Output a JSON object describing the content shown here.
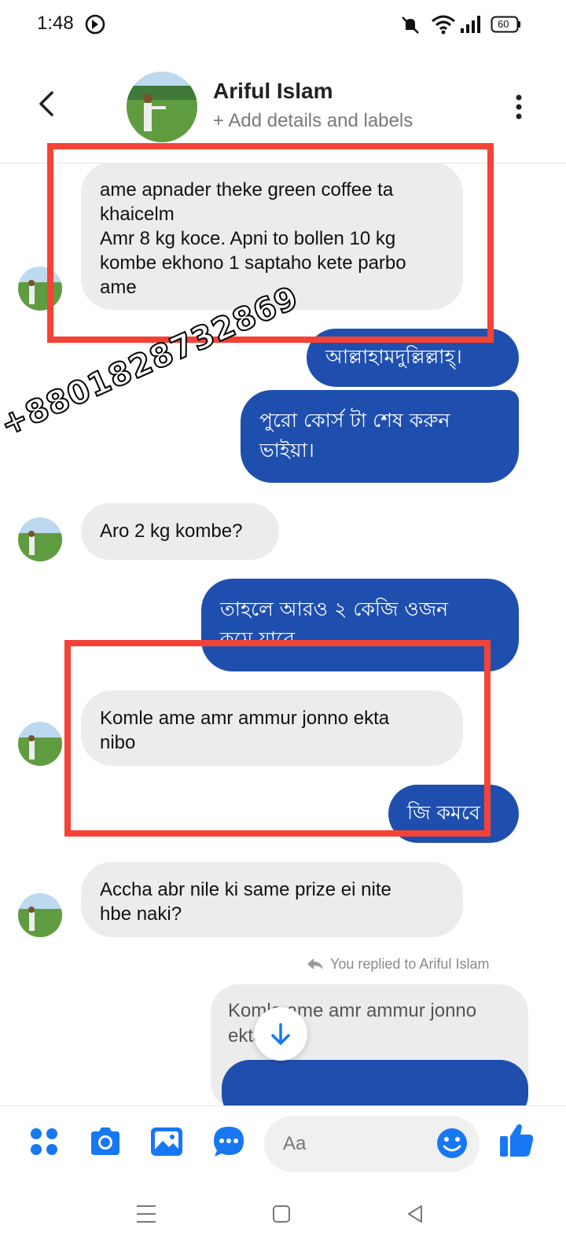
{
  "status_bar": {
    "time": "1:48",
    "battery": "60"
  },
  "header": {
    "name": "Ariful Islam",
    "subtitle": "+ Add details and labels"
  },
  "messages": {
    "m1": [
      "ame apnader theke green coffee ta",
      "khaicelm",
      "Amr 8 kg koce.  Apni to bollen 10 kg",
      "kombe ekhono 1 saptaho kete parbo",
      "ame"
    ],
    "m2": [
      "আল্লাহামদুল্লিল্লাহ্।"
    ],
    "m3": [
      "পুরো কোর্স টা শেষ করুন",
      "ভাইয়া।"
    ],
    "m4": [
      "Aro 2 kg kombe?"
    ],
    "m5": [
      "তাহলে আরও ২ কেজি ওজন",
      "কমে যাবে"
    ],
    "m6": [
      "Komle ame amr ammur jonno ekta",
      "nibo"
    ],
    "m7": [
      "জি কমবে"
    ],
    "m8": [
      "Accha abr nile ki same prize ei nite",
      "hbe naki?"
    ]
  },
  "reply": {
    "note": "You replied to Ariful Islam",
    "quoted_lines": [
      "Komle ame amr ammur jonno",
      "ekta nibo"
    ]
  },
  "watermark": "+8801828732869",
  "composer": {
    "placeholder": "Aa"
  },
  "colors": {
    "accent": "#1877f2",
    "outgoing_bubble": "#1f4fae",
    "incoming_bubble": "#ececec",
    "highlight": "#f44336"
  },
  "icons": [
    "back-arrow-icon",
    "more-vertical-icon",
    "apps-grid-icon",
    "camera-icon",
    "image-icon",
    "chat-more-icon",
    "emoji-icon",
    "thumbs-up-icon",
    "scroll-down-icon",
    "menu-icon",
    "home-square-icon",
    "back-triangle-icon"
  ]
}
